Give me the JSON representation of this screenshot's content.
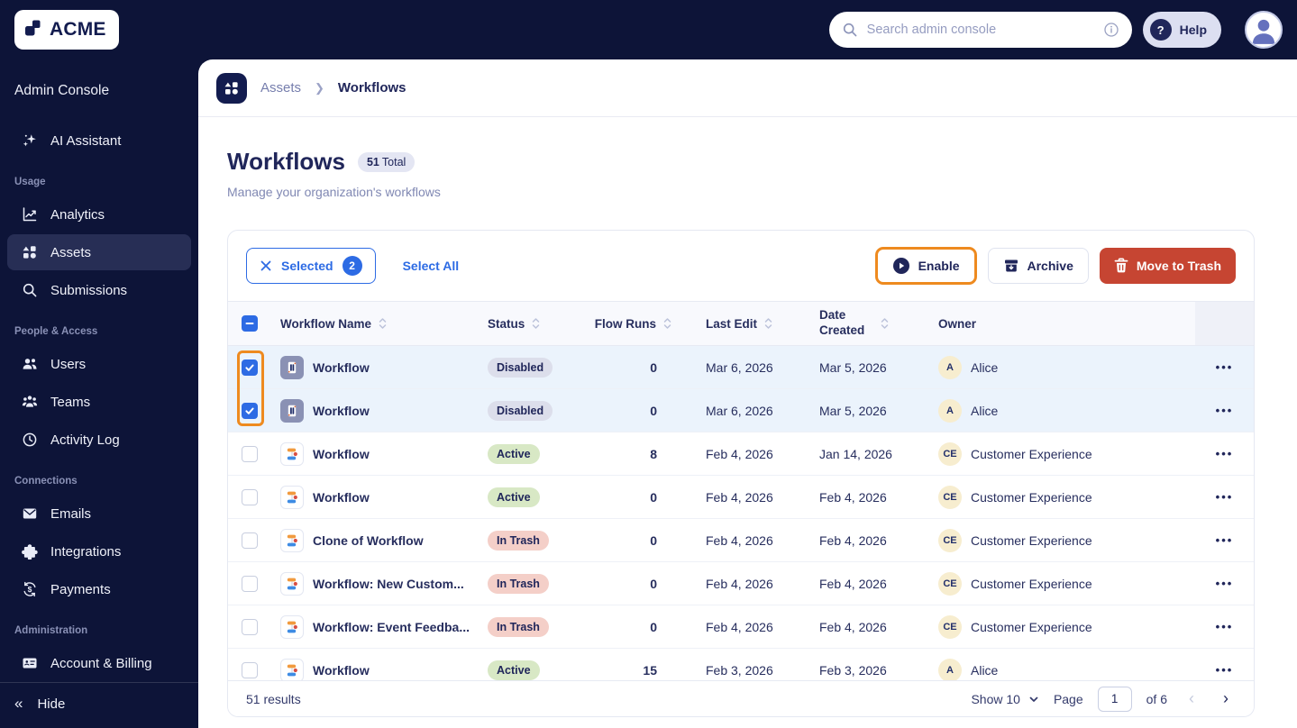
{
  "brand": {
    "name": "ACME"
  },
  "topbar": {
    "search_placeholder": "Search admin console",
    "help_label": "Help"
  },
  "sidebar": {
    "title": "Admin Console",
    "groups": [
      {
        "label": "",
        "items": [
          {
            "label": "AI Assistant",
            "icon": "sparkles",
            "active": false
          }
        ]
      },
      {
        "label": "Usage",
        "items": [
          {
            "label": "Analytics",
            "icon": "chart",
            "active": false
          },
          {
            "label": "Assets",
            "icon": "shapes",
            "active": true
          },
          {
            "label": "Submissions",
            "icon": "search",
            "active": false
          }
        ]
      },
      {
        "label": "People & Access",
        "items": [
          {
            "label": "Users",
            "icon": "users",
            "active": false
          },
          {
            "label": "Teams",
            "icon": "teams",
            "active": false
          },
          {
            "label": "Activity Log",
            "icon": "clock",
            "active": false
          }
        ]
      },
      {
        "label": "Connections",
        "items": [
          {
            "label": "Emails",
            "icon": "mail",
            "active": false
          },
          {
            "label": "Integrations",
            "icon": "puzzle",
            "active": false
          },
          {
            "label": "Payments",
            "icon": "payments",
            "active": false
          }
        ]
      },
      {
        "label": "Administration",
        "items": [
          {
            "label": "Account & Billing",
            "icon": "idcard",
            "active": false
          }
        ]
      }
    ],
    "hide_label": "Hide"
  },
  "breadcrumb": {
    "parent": "Assets",
    "current": "Workflows"
  },
  "page": {
    "title": "Workflows",
    "total_count": "51",
    "total_suffix": "Total",
    "subtitle": "Manage your organization's workflows"
  },
  "toolbar": {
    "selected_label": "Selected",
    "selected_count": "2",
    "select_all_label": "Select All",
    "enable_label": "Enable",
    "archive_label": "Archive",
    "move_to_trash_label": "Move to Trash"
  },
  "table": {
    "columns": [
      {
        "key": "name",
        "label": "Workflow Name",
        "sortable": true
      },
      {
        "key": "status",
        "label": "Status",
        "sortable": true
      },
      {
        "key": "flow_runs",
        "label": "Flow Runs",
        "sortable": true
      },
      {
        "key": "last_edit",
        "label": "Last Edit",
        "sortable": true
      },
      {
        "key": "date_created",
        "label": "Date Created",
        "sortable": true
      },
      {
        "key": "owner",
        "label": "Owner",
        "sortable": false
      }
    ],
    "rows": [
      {
        "name": "Workflow",
        "icon": "paused",
        "status": "Disabled",
        "status_type": "disabled",
        "flow_runs": "0",
        "last_edit": "Mar 6, 2026",
        "date_created": "Mar 5, 2026",
        "owner": "Alice",
        "owner_initials": "A",
        "selected": true
      },
      {
        "name": "Workflow",
        "icon": "paused",
        "status": "Disabled",
        "status_type": "disabled",
        "flow_runs": "0",
        "last_edit": "Mar 6, 2026",
        "date_created": "Mar 5, 2026",
        "owner": "Alice",
        "owner_initials": "A",
        "selected": true
      },
      {
        "name": "Workflow",
        "icon": "active",
        "status": "Active",
        "status_type": "active",
        "flow_runs": "8",
        "last_edit": "Feb 4, 2026",
        "date_created": "Jan 14, 2026",
        "owner": "Customer Experience",
        "owner_initials": "CE",
        "selected": false
      },
      {
        "name": "Workflow",
        "icon": "active",
        "status": "Active",
        "status_type": "active",
        "flow_runs": "0",
        "last_edit": "Feb 4, 2026",
        "date_created": "Feb 4, 2026",
        "owner": "Customer Experience",
        "owner_initials": "CE",
        "selected": false
      },
      {
        "name": "Clone of Workflow",
        "icon": "active",
        "status": "In Trash",
        "status_type": "trash",
        "flow_runs": "0",
        "last_edit": "Feb 4, 2026",
        "date_created": "Feb 4, 2026",
        "owner": "Customer Experience",
        "owner_initials": "CE",
        "selected": false
      },
      {
        "name": "Workflow: New Custom...",
        "icon": "active",
        "status": "In Trash",
        "status_type": "trash",
        "flow_runs": "0",
        "last_edit": "Feb 4, 2026",
        "date_created": "Feb 4, 2026",
        "owner": "Customer Experience",
        "owner_initials": "CE",
        "selected": false
      },
      {
        "name": "Workflow: Event Feedba...",
        "icon": "active",
        "status": "In Trash",
        "status_type": "trash",
        "flow_runs": "0",
        "last_edit": "Feb 4, 2026",
        "date_created": "Feb 4, 2026",
        "owner": "Customer Experience",
        "owner_initials": "CE",
        "selected": false
      },
      {
        "name": "Workflow",
        "icon": "active",
        "status": "Active",
        "status_type": "active",
        "flow_runs": "15",
        "last_edit": "Feb 3, 2026",
        "date_created": "Feb 3, 2026",
        "owner": "Alice",
        "owner_initials": "A",
        "selected": false
      }
    ]
  },
  "footer": {
    "results_label": "51 results",
    "show_label": "Show 10",
    "page_label": "Page",
    "page_value": "1",
    "of_label": "of 6"
  },
  "colors": {
    "accent_blue": "#2D6BE4",
    "danger_red": "#C64532",
    "annotation_orange": "#EE8A1F",
    "navy": "#0D1438"
  }
}
